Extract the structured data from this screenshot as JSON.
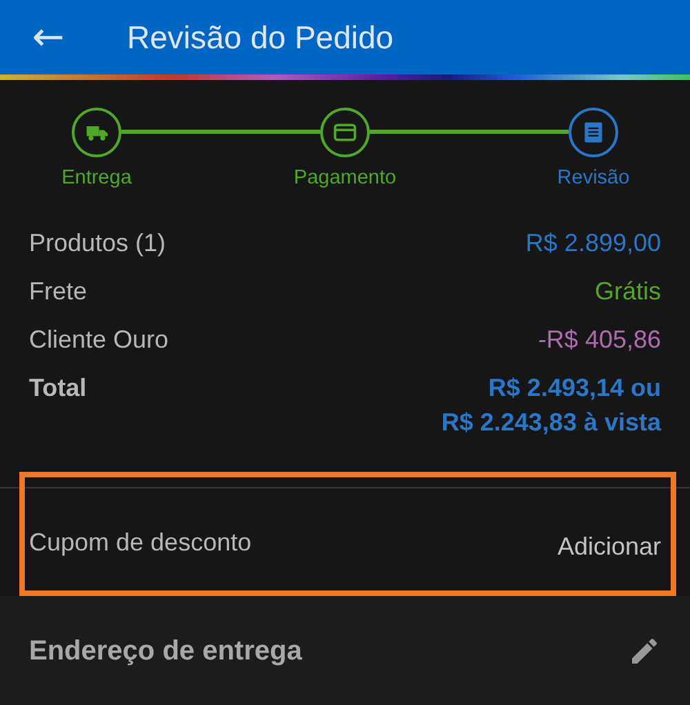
{
  "app_bar": {
    "back_icon": "←",
    "title": "Revisão do Pedido"
  },
  "steps": [
    {
      "label": "Entrega",
      "current": false
    },
    {
      "label": "Pagamento",
      "current": false
    },
    {
      "label": "Revisão",
      "current": true
    }
  ],
  "summary": [
    {
      "label": "Produtos (1)",
      "value": "R$ 2.899,00",
      "color": "#2a76c9",
      "bold": false
    },
    {
      "label": "Frete",
      "value": "Grátis",
      "color": "#56a32e",
      "bold": false
    },
    {
      "label": "Cliente Ouro",
      "value": "-R$ 405,86",
      "color": "#b06ab0",
      "bold": false
    },
    {
      "label": "Total",
      "value": "R$ 2.493,14 ou",
      "value_2": "R$ 2.243,83 à vista",
      "color": "#2a76c9",
      "bold": true
    }
  ],
  "coupon": {
    "label": "Cupom de desconto",
    "action": "Adicionar",
    "highlighted": true
  },
  "address": {
    "title": "Endereço de entrega"
  }
}
